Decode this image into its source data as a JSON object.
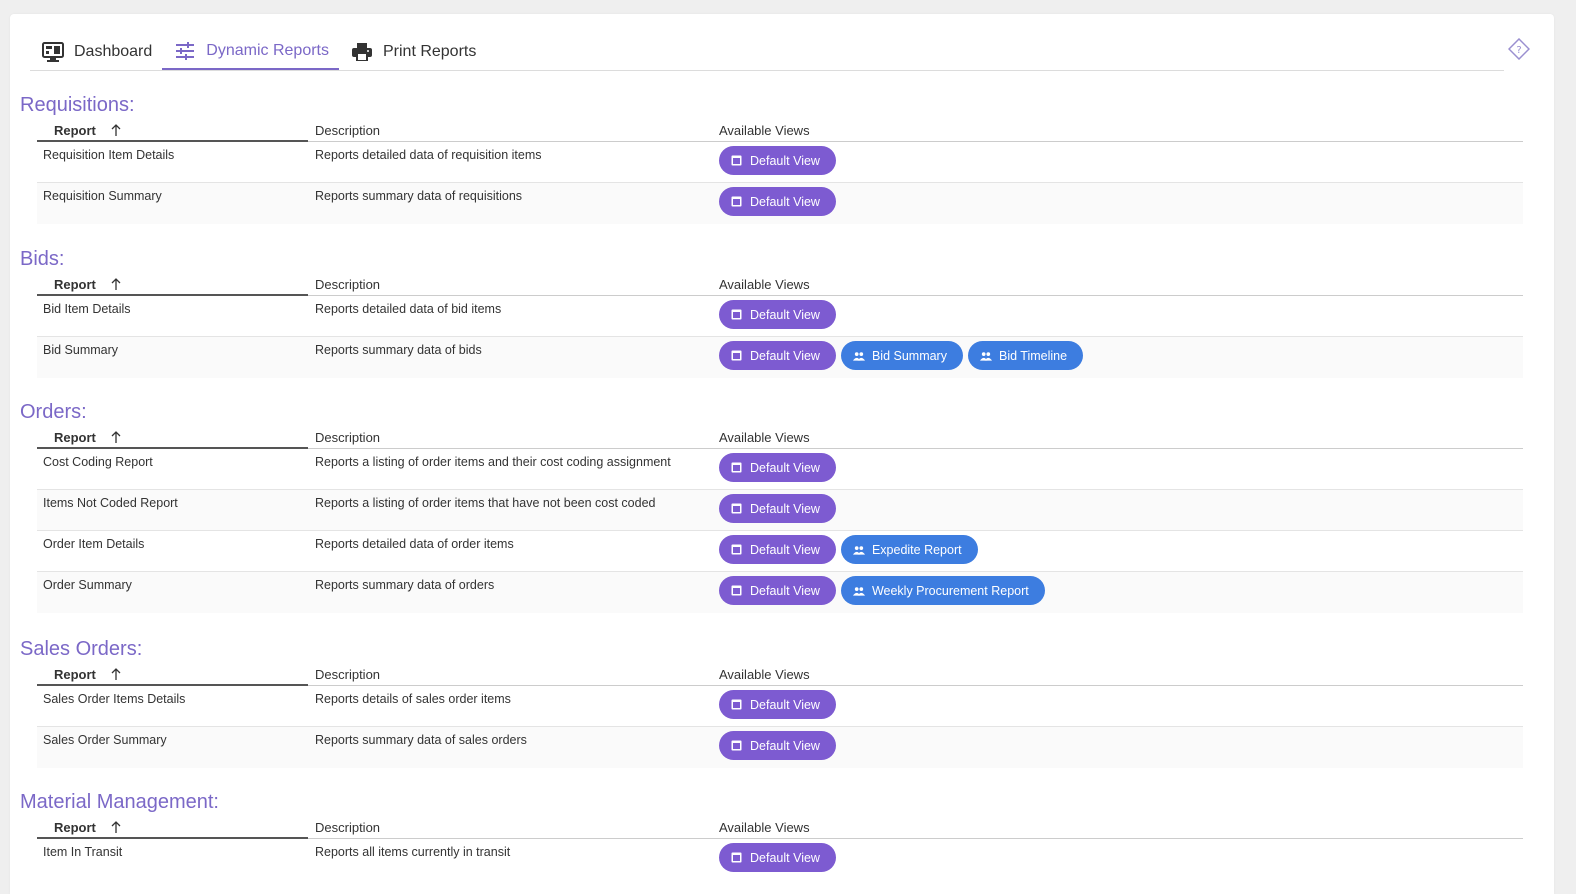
{
  "tabs": [
    {
      "label": "Dashboard",
      "icon": "monitor-icon",
      "active": false
    },
    {
      "label": "Dynamic Reports",
      "icon": "sliders-icon",
      "active": true
    },
    {
      "label": "Print Reports",
      "icon": "printer-icon",
      "active": false
    }
  ],
  "colors": {
    "accent": "#7b68c7",
    "default_button": "#7d5bd1",
    "group_button": "#3d7de0"
  },
  "columns": {
    "report": "Report",
    "description": "Description",
    "views": "Available Views"
  },
  "sections": [
    {
      "title": "Requisitions:",
      "rows": [
        {
          "report": "Requisition Item Details",
          "description": "Reports detailed data of requisition items",
          "views": [
            {
              "label": "Default View",
              "type": "default"
            }
          ]
        },
        {
          "report": "Requisition Summary",
          "description": "Reports summary data of requisitions",
          "views": [
            {
              "label": "Default View",
              "type": "default"
            }
          ]
        }
      ]
    },
    {
      "title": "Bids:",
      "rows": [
        {
          "report": "Bid Item Details",
          "description": "Reports detailed data of bid items",
          "views": [
            {
              "label": "Default View",
              "type": "default"
            }
          ]
        },
        {
          "report": "Bid Summary",
          "description": "Reports summary data of bids",
          "views": [
            {
              "label": "Default View",
              "type": "default"
            },
            {
              "label": "Bid Summary",
              "type": "group"
            },
            {
              "label": "Bid Timeline",
              "type": "group"
            }
          ]
        }
      ]
    },
    {
      "title": "Orders:",
      "rows": [
        {
          "report": "Cost Coding Report",
          "description": "Reports a listing of order items and their cost coding assignment",
          "views": [
            {
              "label": "Default View",
              "type": "default"
            }
          ]
        },
        {
          "report": "Items Not Coded Report",
          "description": "Reports a listing of order items that have not been cost coded",
          "views": [
            {
              "label": "Default View",
              "type": "default"
            }
          ]
        },
        {
          "report": "Order Item Details",
          "description": "Reports detailed data of order items",
          "views": [
            {
              "label": "Default View",
              "type": "default"
            },
            {
              "label": "Expedite Report",
              "type": "group"
            }
          ]
        },
        {
          "report": "Order Summary",
          "description": "Reports summary data of orders",
          "views": [
            {
              "label": "Default View",
              "type": "default"
            },
            {
              "label": "Weekly Procurement Report",
              "type": "group"
            }
          ]
        }
      ]
    },
    {
      "title": "Sales Orders:",
      "rows": [
        {
          "report": "Sales Order Items Details",
          "description": "Reports details of sales order items",
          "views": [
            {
              "label": "Default View",
              "type": "default"
            }
          ]
        },
        {
          "report": "Sales Order Summary",
          "description": "Reports summary data of sales orders",
          "views": [
            {
              "label": "Default View",
              "type": "default"
            }
          ]
        }
      ]
    },
    {
      "title": "Material Management:",
      "rows": [
        {
          "report": "Item In Transit",
          "description": "Reports all items currently in transit",
          "views": [
            {
              "label": "Default View",
              "type": "default"
            }
          ]
        }
      ]
    }
  ]
}
